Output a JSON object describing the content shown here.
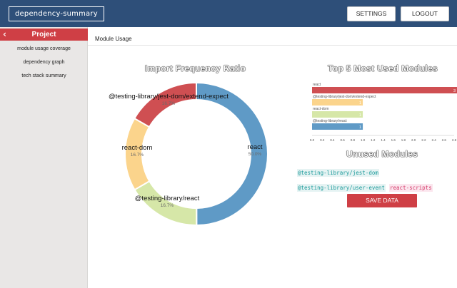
{
  "header": {
    "brand": "dependency-summary",
    "settings_label": "SETTINGS",
    "logout_label": "LOGOUT",
    "accent": "#2e4f79"
  },
  "sidebar": {
    "back_icon": "chevron-left-icon",
    "title": "Project",
    "items": [
      {
        "label": "module usage coverage"
      },
      {
        "label": "dependency graph"
      },
      {
        "label": "tech stack summary"
      }
    ]
  },
  "main": {
    "title": "Module Usage",
    "import_ratio_title": "Import Frequency Ratio",
    "top_modules_title": "Top 5 Most Used Modules",
    "unused_title": "Unused Modules",
    "unused_modules": [
      "@testing-library/jest-dom",
      "@testing-library/user-event",
      "react-scripts"
    ],
    "save_label": "SAVE DATA"
  },
  "chart_data": [
    {
      "type": "pie",
      "title": "Import Frequency Ratio",
      "slices": [
        {
          "label": "react",
          "pct_label": "50.0%",
          "value": 50.0,
          "color": "#5f9ac6"
        },
        {
          "label": "@testing-library/react",
          "pct_label": "16.7%",
          "value": 16.7,
          "color": "#d6e7a8"
        },
        {
          "label": "react-dom",
          "pct_label": "16.7%",
          "value": 16.7,
          "color": "#fbd48c"
        },
        {
          "label": "@testing-library/jest-dom/extend-expect",
          "pct_label": "16.7%",
          "value": 16.7,
          "color": "#cf4f52"
        }
      ]
    },
    {
      "type": "bar",
      "title": "Top 5 Most Used Modules",
      "orientation": "horizontal",
      "categories": [
        "react",
        "@testing-library/jest-dom/extend-expect",
        "react-dom",
        "@testing-library/react"
      ],
      "values": [
        3,
        1,
        1,
        1
      ],
      "colors": [
        "#cf4f52",
        "#fbd48c",
        "#d6e7a8",
        "#5f9ac6"
      ],
      "xlim": [
        0,
        2.8
      ],
      "xticks": [
        "0.0",
        "0.2",
        "0.4",
        "0.6",
        "0.8",
        "1.0",
        "1.2",
        "1.4",
        "1.6",
        "1.8",
        "2.0",
        "2.2",
        "2.4",
        "2.6",
        "2.8"
      ]
    }
  ]
}
